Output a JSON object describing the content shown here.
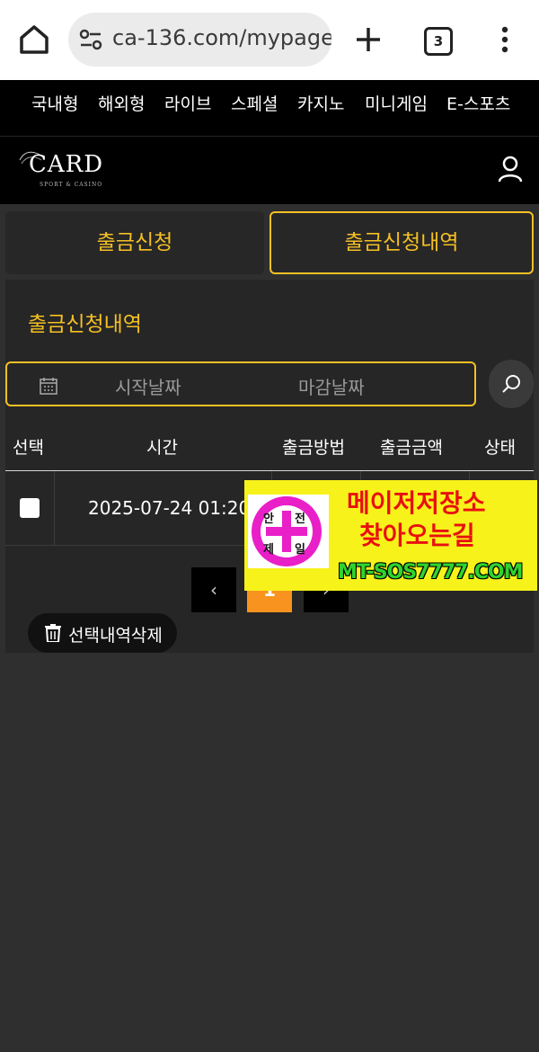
{
  "browser": {
    "url": "ca-136.com/mypage/",
    "tab_count": "3"
  },
  "nav": {
    "items": [
      "국내형",
      "해외형",
      "라이브",
      "스페셜",
      "카지노",
      "미니게임",
      "E-스포츠"
    ]
  },
  "logo": {
    "main": "CARD",
    "sub": "SPORT & CASINO"
  },
  "tabs": [
    {
      "label": "출금신청",
      "active": false
    },
    {
      "label": "출금신청내역",
      "active": true
    }
  ],
  "panel": {
    "title": "출금신청내역",
    "start_date_placeholder": "시작날짜",
    "end_date_placeholder": "마감날짜"
  },
  "table": {
    "headers": [
      "선택",
      "시간",
      "출금방법",
      "출금금액",
      "상태"
    ],
    "rows": [
      {
        "time": "2025-07-24 01:20",
        "method": "",
        "amount": "",
        "status": ""
      }
    ]
  },
  "pagination": {
    "prev": "‹",
    "current": "1",
    "next": "›"
  },
  "delete_button": "선택내역삭제",
  "ad": {
    "badge_chars": [
      "안",
      "전",
      "제",
      "일"
    ],
    "line1": "메이저저장소",
    "line2": "찾아오는길",
    "url": "MT-SOS7777.COM"
  },
  "colors": {
    "accent": "#f5c024",
    "page_current": "#f7931e",
    "ad_bg": "#f7f21a",
    "ad_text": "#e81010",
    "ad_badge": "#e91fc8"
  }
}
